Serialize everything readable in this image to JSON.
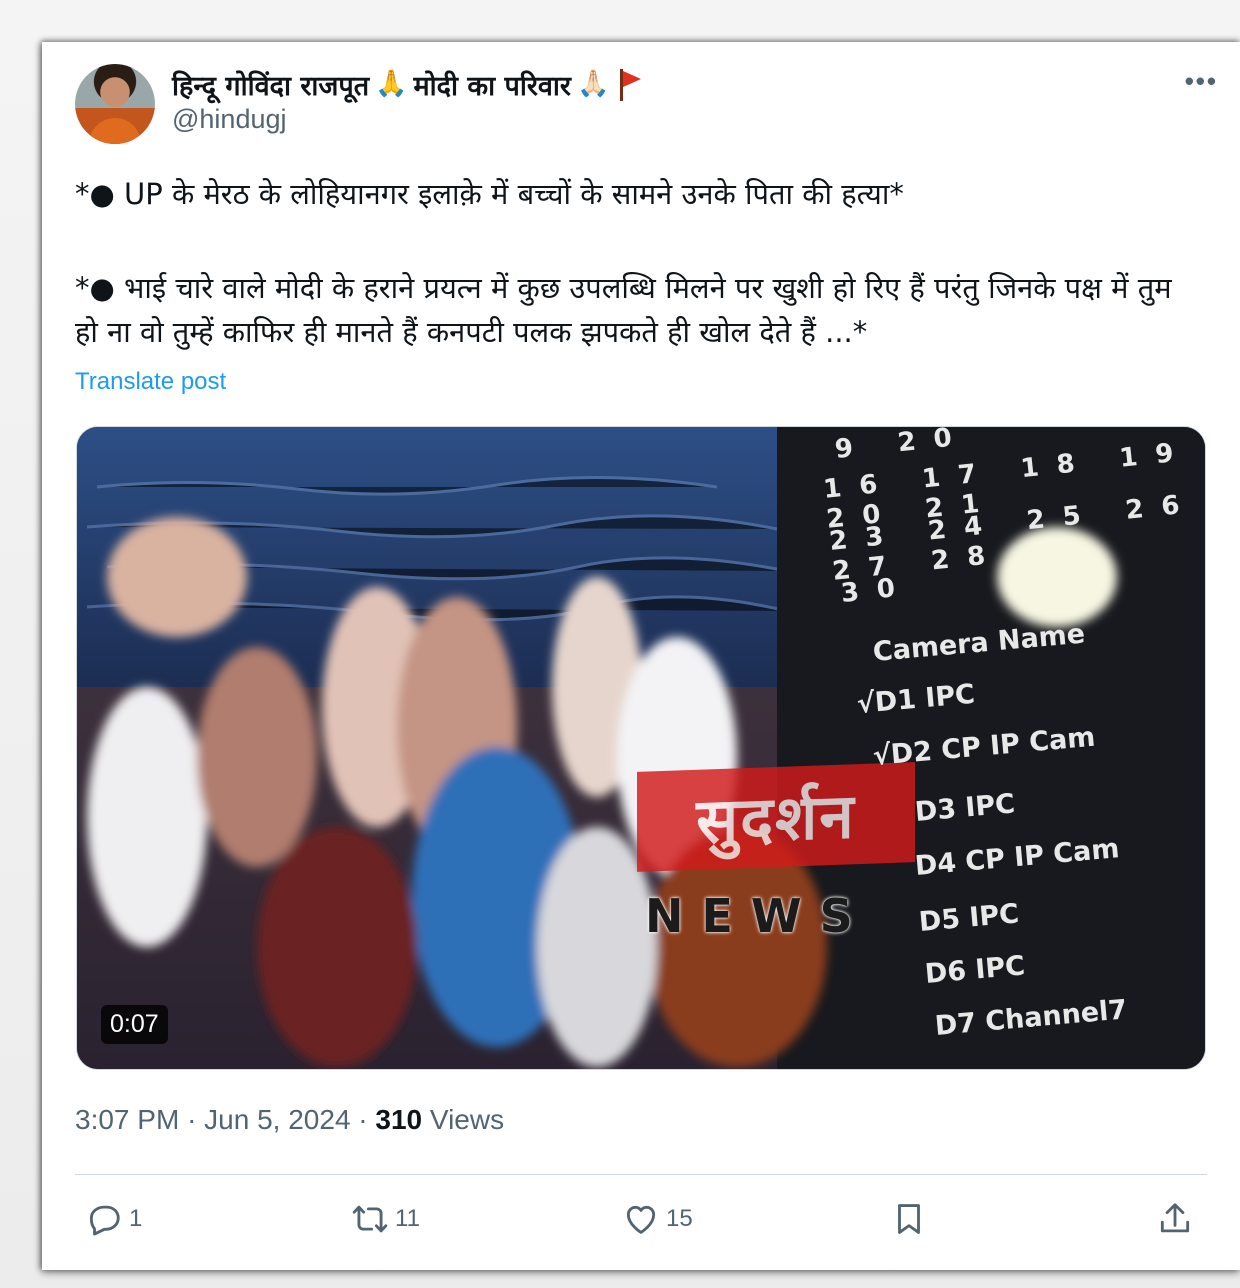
{
  "post": {
    "display_name": "हिन्दू गोविंदा राजपूत",
    "display_name_tail": "मोदी का परिवार",
    "emoji_pray_1": "🙏",
    "emoji_pray_2": "🙏🏻",
    "handle": "@hindugj",
    "more_label": "•••",
    "line1": "*● UP के मेरठ के लोहियानगर इलाक़े में बच्चों के सामने उनके पिता की हत्या*",
    "line2": "*● भाई चारे वाले मोदी के हराने प्रयत्न में कुछ उपलब्धि मिलने पर खुशी हो रिए हैं परंतु जिनके पक्ष में तुम हो ना वो तुम्हें काफिर ही मानते हैं कनपटी पलक झपकते ही खोल देते हैं ...*",
    "translate_label": "Translate post"
  },
  "video": {
    "duration": "0:07",
    "logo_text": "सुदर्शन",
    "logo_sub": "NEWS",
    "calendar_rows": [
      "9 20",
      "16 17 18 19 20 21",
      "23 24 25 26 27 28",
      "30"
    ],
    "camera_header": "Camera Name",
    "camera_items": [
      "√D1 IPC",
      "√D2 CP IP Cam",
      "D3 IPC",
      "D4 CP IP Cam",
      "D5 IPC",
      "D6 IPC",
      "D7 Channel7"
    ]
  },
  "meta": {
    "time": "3:07 PM",
    "date": "Jun 5, 2024",
    "views_count": "310",
    "views_label": "Views",
    "separator": "·"
  },
  "actions": {
    "replies": "1",
    "reposts": "11",
    "likes": "15"
  },
  "icons": {
    "reply": "reply-icon",
    "repost": "repost-icon",
    "like": "heart-icon",
    "bookmark": "bookmark-icon",
    "share": "share-icon",
    "more": "more-icon",
    "flag": "flag-icon"
  },
  "colors": {
    "link": "#1d9bf0",
    "secondary_text": "#536471",
    "primary_text": "#0f1419"
  }
}
